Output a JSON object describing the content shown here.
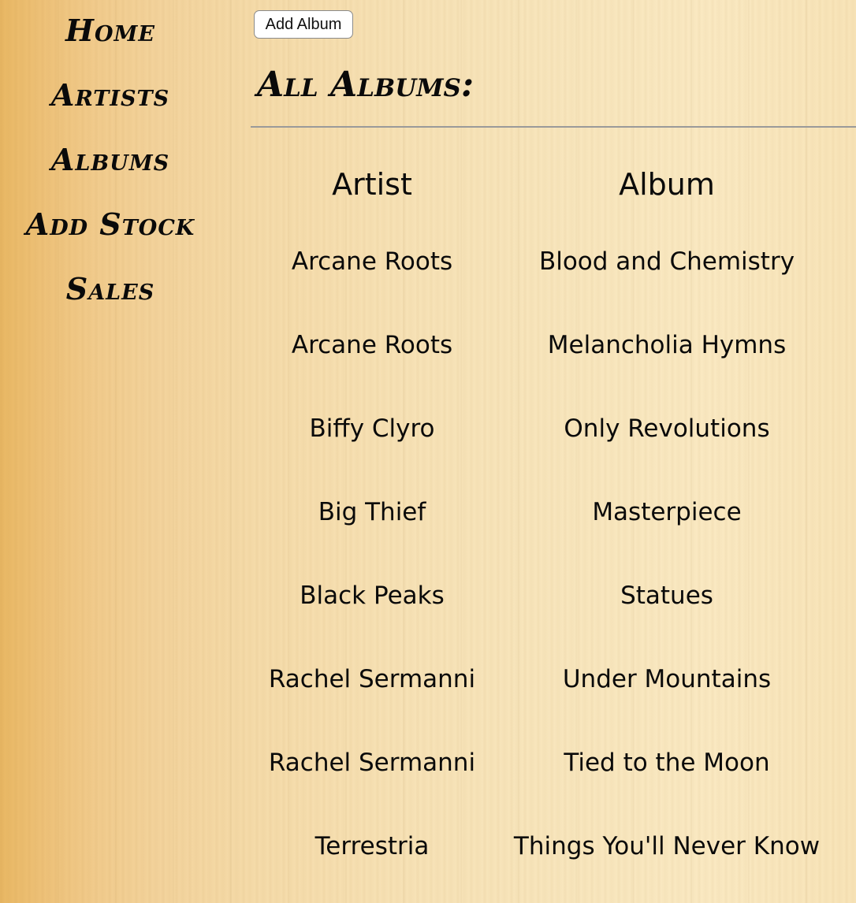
{
  "nav": {
    "items": [
      {
        "label": "Home"
      },
      {
        "label": "Artists"
      },
      {
        "label": "Albums"
      },
      {
        "label": "Add Stock"
      },
      {
        "label": "Sales"
      }
    ]
  },
  "main": {
    "add_button_label": "Add Album",
    "title": "All Albums:",
    "table": {
      "headers": [
        "Artist",
        "Album"
      ],
      "rows": [
        {
          "artist": "Arcane Roots",
          "album": "Blood and Chemistry"
        },
        {
          "artist": "Arcane Roots",
          "album": "Melancholia Hymns"
        },
        {
          "artist": "Biffy Clyro",
          "album": "Only Revolutions"
        },
        {
          "artist": "Big Thief",
          "album": "Masterpiece"
        },
        {
          "artist": "Black Peaks",
          "album": "Statues"
        },
        {
          "artist": "Rachel Sermanni",
          "album": "Under Mountains"
        },
        {
          "artist": "Rachel Sermanni",
          "album": "Tied to the Moon"
        },
        {
          "artist": "Terrestria",
          "album": "Things You'll Never Know"
        }
      ]
    }
  },
  "colors": {
    "text": "#0a0a0a",
    "divider": "#9a9a9a",
    "background": "#f4d9a8"
  }
}
